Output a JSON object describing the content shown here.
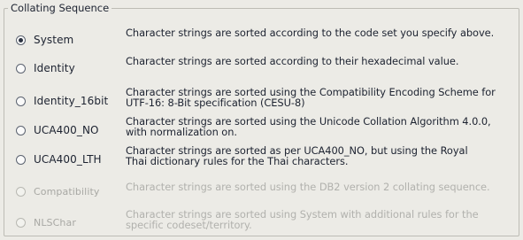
{
  "group": {
    "title": "Collating Sequence"
  },
  "options": [
    {
      "label": "System",
      "checked": true,
      "enabled": true,
      "description": [
        "Character strings are sorted according to the code set you specify above."
      ]
    },
    {
      "label": "Identity",
      "checked": false,
      "enabled": true,
      "description": [
        "Character strings are sorted according to their hexadecimal value."
      ]
    },
    {
      "label": "Identity_16bit",
      "checked": false,
      "enabled": true,
      "description": [
        "Character strings are sorted using the Compatibility Encoding Scheme for",
        "UTF-16: 8-Bit specification (CESU-8)"
      ]
    },
    {
      "label": "UCA400_NO",
      "checked": false,
      "enabled": true,
      "description": [
        "Character strings are sorted using the Unicode Collation Algorithm 4.0.0,",
        "with normalization on."
      ]
    },
    {
      "label": "UCA400_LTH",
      "checked": false,
      "enabled": true,
      "description": [
        "Character strings are sorted as per UCA400_NO, but using the Royal",
        "Thai dictionary rules for the Thai characters."
      ]
    },
    {
      "label": "Compatibility",
      "checked": false,
      "enabled": false,
      "description": [
        "Character strings are sorted using the DB2 version 2 collating sequence."
      ]
    },
    {
      "label": "NLSChar",
      "checked": false,
      "enabled": false,
      "description": [
        "Character strings are sorted using System with additional rules for the",
        "specific codeset/territory."
      ]
    }
  ]
}
